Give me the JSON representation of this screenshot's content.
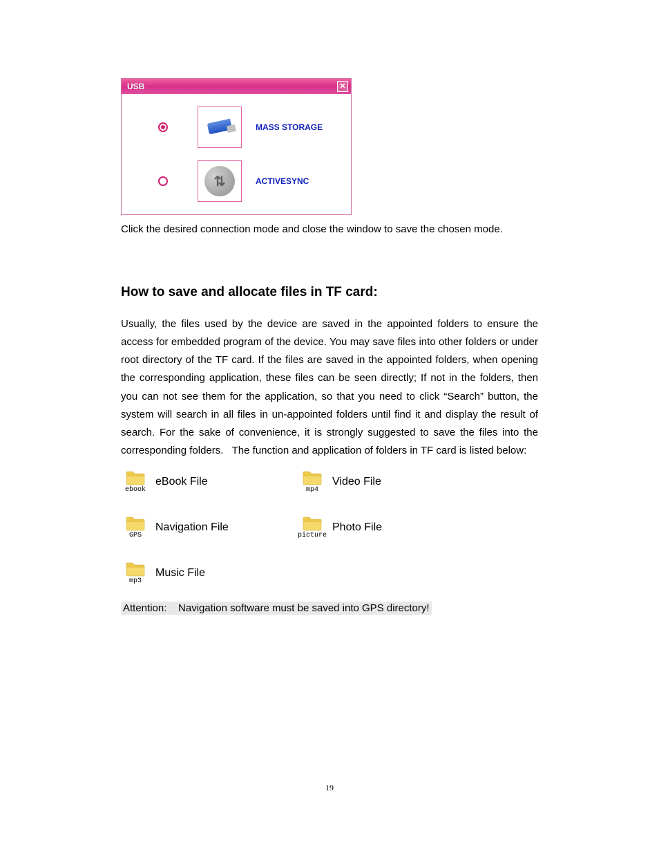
{
  "usb_dialog": {
    "title": "USB",
    "close_glyph": "✕",
    "options": [
      {
        "label": "MASS STORAGE",
        "selected": true
      },
      {
        "label": "ACTIVESYNC",
        "selected": false
      }
    ],
    "sync_glyph": "⇅"
  },
  "caption_text": "Click the desired connection mode and close the window to save the chosen mode.",
  "heading": "How to save and allocate files in TF card:",
  "body_text": "Usually, the files used by the device are saved in the appointed folders to ensure the access for embedded program of the device. You may save files into other folders or under root directory of the TF card. If the files are saved in the appointed folders, when opening the corresponding application, these files can be seen directly; If not in the folders, then you can not see them for the application, so that you need to click “Search” button, the system will search in all files in un-appointed folders until find it and display the result of search. For the sake of convenience, it is strongly suggested to save the files into the corresponding folders.   The function and application of folders in TF card is listed below:",
  "folders": [
    {
      "caption": "ebook",
      "label": "eBook File"
    },
    {
      "caption": "mp4",
      "label": "Video File"
    },
    {
      "caption": "GPS",
      "label": "Navigation File"
    },
    {
      "caption": "picture",
      "label": "Photo File"
    },
    {
      "caption": "mp3",
      "label": "Music File"
    }
  ],
  "attention": "Attention:    Navigation software must be saved into GPS directory!",
  "page_number": "19"
}
